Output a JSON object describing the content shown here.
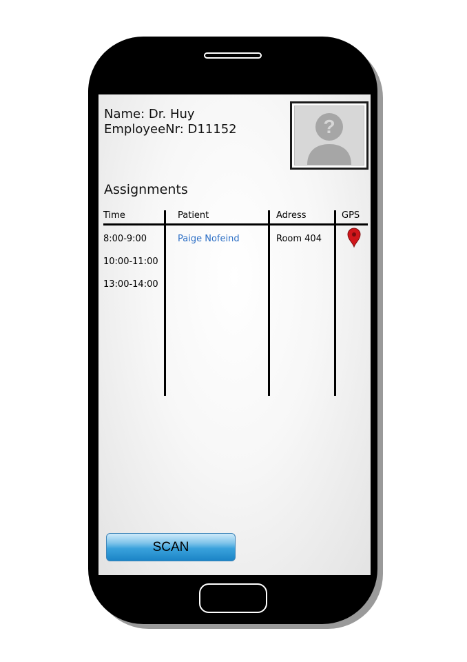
{
  "profile": {
    "name_line": "Name: Dr. Huy",
    "employee_line": "EmployeeNr: D11152",
    "avatar_icon": "unknown-user-icon"
  },
  "assignments": {
    "title": "Assignments",
    "columns": [
      "Time",
      "Patient",
      "Adress",
      "GPS"
    ],
    "rows": [
      {
        "time": "8:00-9:00",
        "patient": "Paige Nofeind",
        "address": "Room 404",
        "gps_icon": "map-pin-icon"
      },
      {
        "time": "10:00-11:00",
        "patient": "",
        "address": "",
        "gps_icon": ""
      },
      {
        "time": "13:00-14:00",
        "patient": "",
        "address": "",
        "gps_icon": ""
      }
    ]
  },
  "actions": {
    "scan_label": "SCAN"
  },
  "colors": {
    "link": "#2b6ec5",
    "pin": "#d0161b",
    "scan_button": "#3aa2dc"
  }
}
